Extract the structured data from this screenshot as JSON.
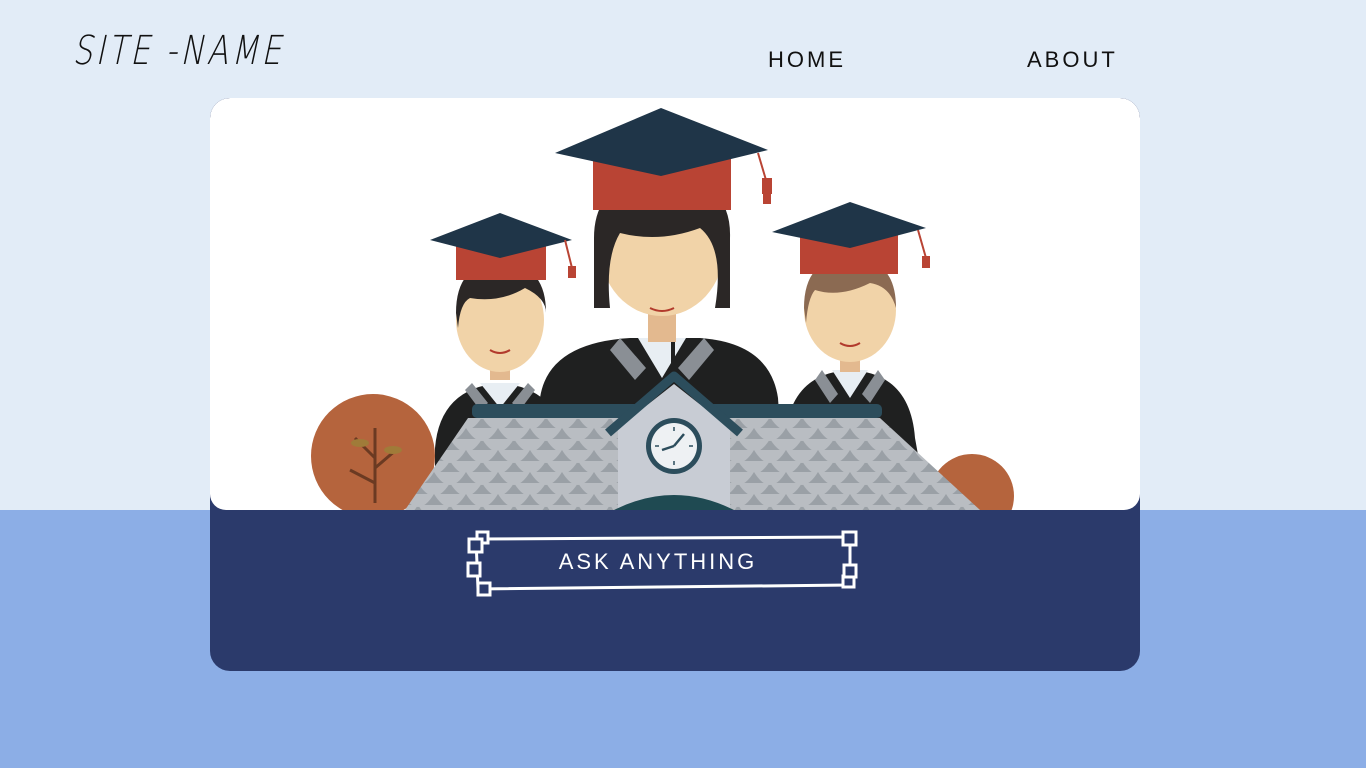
{
  "header": {
    "site_name": "SITE -NAME",
    "nav": [
      {
        "label": "HOME"
      },
      {
        "label": "ABOUT"
      }
    ]
  },
  "hero": {
    "illustration": "graduates-with-school-building"
  },
  "cta": {
    "label": "ASK ANYTHING"
  },
  "colors": {
    "page_top": "#e2ecf7",
    "page_bottom": "#8caee6",
    "card_bottom": "#2b3a6b",
    "cap": "#1f3548",
    "cap_band": "#b94434",
    "tree": "#b5643d"
  }
}
